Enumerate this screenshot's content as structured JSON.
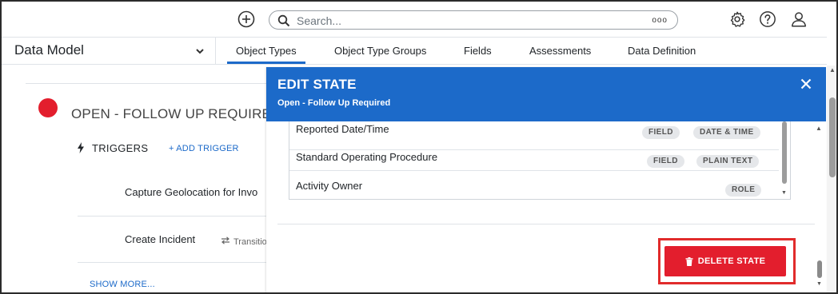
{
  "topbar": {
    "search_placeholder": "Search...",
    "more_icon_text": "ooo"
  },
  "nav": {
    "model_label": "Data Model",
    "tabs": [
      {
        "label": "Object Types",
        "active": true
      },
      {
        "label": "Object Type Groups",
        "active": false
      },
      {
        "label": "Fields",
        "active": false
      },
      {
        "label": "Assessments",
        "active": false
      },
      {
        "label": "Data Definition",
        "active": false
      }
    ]
  },
  "background": {
    "state_title": "OPEN - FOLLOW UP REQUIRE",
    "triggers_label": "TRIGGERS",
    "add_trigger_label": "+ ADD TRIGGER",
    "trigger_rows": [
      {
        "label": "Capture Geolocation for Invo"
      },
      {
        "label": "Create Incident"
      }
    ],
    "transition_label": "Transitio",
    "show_more_label": "SHOW MORE..."
  },
  "modal": {
    "title": "EDIT STATE",
    "subtitle": "Open - Follow Up Required",
    "rows": [
      {
        "label": "Reported Date/Time",
        "badges": [
          "FIELD",
          "DATE & TIME"
        ]
      },
      {
        "label": "Standard Operating Procedure",
        "badges": [
          "FIELD",
          "PLAIN TEXT"
        ]
      },
      {
        "label": "Activity Owner",
        "badges": [
          "ROLE"
        ]
      }
    ],
    "delete_label": "DELETE STATE"
  },
  "colors": {
    "accent": "#1c6ac9",
    "danger": "#e31e2d",
    "highlight_outline": "#e12b2b"
  },
  "icons": [
    "add-circle-icon",
    "search-icon",
    "more-icon",
    "gear-icon",
    "help-icon",
    "user-icon",
    "chevron-down-icon",
    "bolt-icon",
    "transition-icon",
    "close-icon",
    "trash-icon"
  ]
}
